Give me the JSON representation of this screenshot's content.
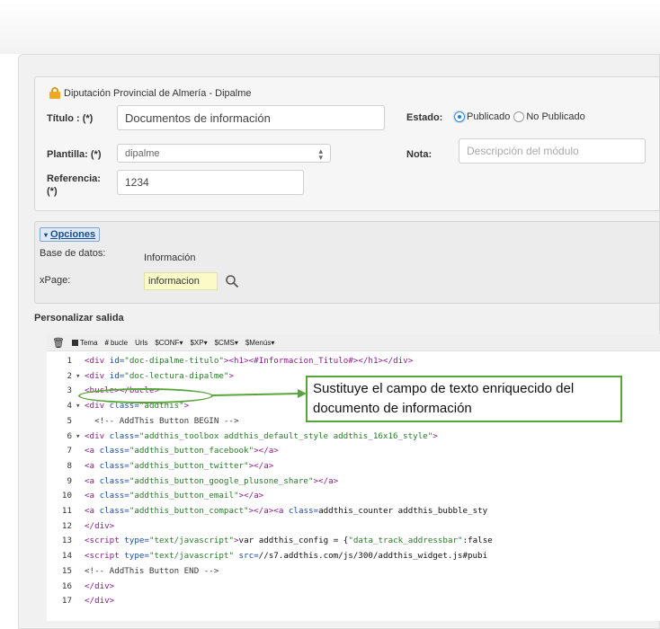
{
  "header": {
    "organization": "Diputación Provincial de Almería - Dipalme"
  },
  "form": {
    "titulo_label": "Título : (*)",
    "titulo_value": "Documentos de información",
    "estado_label": "Estado:",
    "estado_options": [
      "Publicado",
      "No Publicado"
    ],
    "estado_selected": "Publicado",
    "plantilla_label": "Plantilla: (*)",
    "plantilla_value": "dipalme",
    "nota_label": "Nota:",
    "nota_placeholder": "Descripción del módulo",
    "referencia_label": "Referencia:",
    "referencia_required": "(*)",
    "referencia_value": "1234"
  },
  "opciones": {
    "toggle_label": "Opciones",
    "base_datos_label": "Base de datos:",
    "base_datos_value": "Información",
    "xpage_label": "xPage:",
    "xpage_value": "informacion"
  },
  "personalizar": {
    "title": "Personalizar salida",
    "toolbar": [
      "Tema",
      "bucle",
      "Urls",
      "$CONF▾",
      "$XP▾",
      "$CMS▾",
      "$Menús▾"
    ]
  },
  "code_lines": [
    {
      "n": "1",
      "fold": "",
      "text": "<div id=\"doc-dipalme-titulo\"><h1><#Informacion_Titulo#></h1></div>"
    },
    {
      "n": "2",
      "fold": "▾",
      "text": "<div id=\"doc-lectura-dipalme\">"
    },
    {
      "n": "3",
      "fold": "",
      "text": "<bucle></bucle>"
    },
    {
      "n": "4",
      "fold": "▾",
      "text": "<div class=\"addthis\">"
    },
    {
      "n": "5",
      "fold": "",
      "text": "  <!-- AddThis Button BEGIN -->"
    },
    {
      "n": "6",
      "fold": "▾",
      "text": "<div class=\"addthis_toolbox addthis_default_style addthis_16x16_style\">"
    },
    {
      "n": "7",
      "fold": "",
      "text": "<a class=\"addthis_button_facebook\"></a>"
    },
    {
      "n": "8",
      "fold": "",
      "text": "<a class=\"addthis_button_twitter\"></a>"
    },
    {
      "n": "9",
      "fold": "",
      "text": "<a class=\"addthis_button_google_plusone_share\"></a>"
    },
    {
      "n": "10",
      "fold": "",
      "text": "<a class=\"addthis_button_email\"></a>"
    },
    {
      "n": "11",
      "fold": "",
      "text": "<a class=\"addthis_button_compact\"></a><a class=\"addthis_counter addthis_bubble_sty"
    },
    {
      "n": "12",
      "fold": "",
      "text": "</div>"
    },
    {
      "n": "13",
      "fold": "",
      "text": "<script type=\"text/javascript\">var addthis_config = {\"data_track_addressbar\":false"
    },
    {
      "n": "14",
      "fold": "",
      "text": "<script type=\"text/javascript\" src=\"//s7.addthis.com/js/300/addthis_widget.js#pubi"
    },
    {
      "n": "15",
      "fold": "",
      "text": "<!-- AddThis Button END -->"
    },
    {
      "n": "16",
      "fold": "",
      "text": "</div>"
    },
    {
      "n": "17",
      "fold": "",
      "text": "</div>"
    }
  ],
  "annotation": {
    "callout_text": "Sustituye el campo de texto enriquecido del documento de información"
  },
  "colors": {
    "callout_border": "#5aa53a",
    "radio_accent": "#2a7bd6",
    "xpage_highlight": "#fbfbc8",
    "code_tag": "#8a1f8a",
    "code_attr": "#1d4fa3",
    "code_string": "#2b7a2b"
  }
}
